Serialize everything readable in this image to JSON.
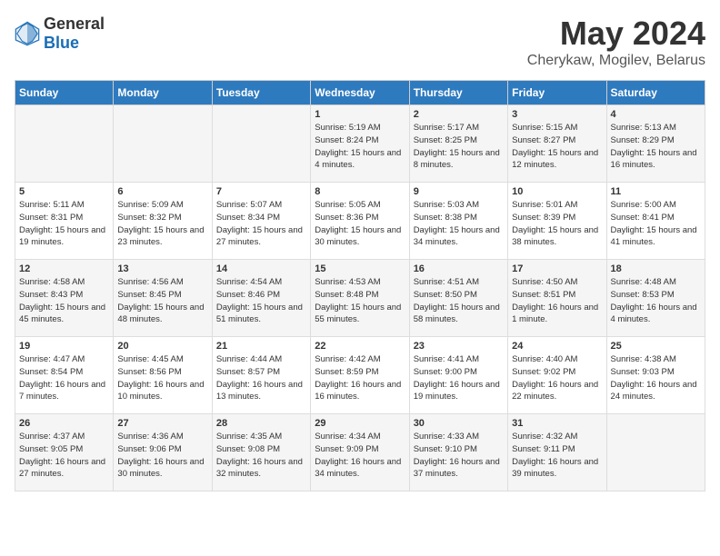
{
  "header": {
    "logo_general": "General",
    "logo_blue": "Blue",
    "title": "May 2024",
    "location": "Cherykaw, Mogilev, Belarus"
  },
  "days_of_week": [
    "Sunday",
    "Monday",
    "Tuesday",
    "Wednesday",
    "Thursday",
    "Friday",
    "Saturday"
  ],
  "weeks": [
    [
      {
        "day": "",
        "sunrise": "",
        "sunset": "",
        "daylight": ""
      },
      {
        "day": "",
        "sunrise": "",
        "sunset": "",
        "daylight": ""
      },
      {
        "day": "",
        "sunrise": "",
        "sunset": "",
        "daylight": ""
      },
      {
        "day": "1",
        "sunrise": "Sunrise: 5:19 AM",
        "sunset": "Sunset: 8:24 PM",
        "daylight": "Daylight: 15 hours and 4 minutes."
      },
      {
        "day": "2",
        "sunrise": "Sunrise: 5:17 AM",
        "sunset": "Sunset: 8:25 PM",
        "daylight": "Daylight: 15 hours and 8 minutes."
      },
      {
        "day": "3",
        "sunrise": "Sunrise: 5:15 AM",
        "sunset": "Sunset: 8:27 PM",
        "daylight": "Daylight: 15 hours and 12 minutes."
      },
      {
        "day": "4",
        "sunrise": "Sunrise: 5:13 AM",
        "sunset": "Sunset: 8:29 PM",
        "daylight": "Daylight: 15 hours and 16 minutes."
      }
    ],
    [
      {
        "day": "5",
        "sunrise": "Sunrise: 5:11 AM",
        "sunset": "Sunset: 8:31 PM",
        "daylight": "Daylight: 15 hours and 19 minutes."
      },
      {
        "day": "6",
        "sunrise": "Sunrise: 5:09 AM",
        "sunset": "Sunset: 8:32 PM",
        "daylight": "Daylight: 15 hours and 23 minutes."
      },
      {
        "day": "7",
        "sunrise": "Sunrise: 5:07 AM",
        "sunset": "Sunset: 8:34 PM",
        "daylight": "Daylight: 15 hours and 27 minutes."
      },
      {
        "day": "8",
        "sunrise": "Sunrise: 5:05 AM",
        "sunset": "Sunset: 8:36 PM",
        "daylight": "Daylight: 15 hours and 30 minutes."
      },
      {
        "day": "9",
        "sunrise": "Sunrise: 5:03 AM",
        "sunset": "Sunset: 8:38 PM",
        "daylight": "Daylight: 15 hours and 34 minutes."
      },
      {
        "day": "10",
        "sunrise": "Sunrise: 5:01 AM",
        "sunset": "Sunset: 8:39 PM",
        "daylight": "Daylight: 15 hours and 38 minutes."
      },
      {
        "day": "11",
        "sunrise": "Sunrise: 5:00 AM",
        "sunset": "Sunset: 8:41 PM",
        "daylight": "Daylight: 15 hours and 41 minutes."
      }
    ],
    [
      {
        "day": "12",
        "sunrise": "Sunrise: 4:58 AM",
        "sunset": "Sunset: 8:43 PM",
        "daylight": "Daylight: 15 hours and 45 minutes."
      },
      {
        "day": "13",
        "sunrise": "Sunrise: 4:56 AM",
        "sunset": "Sunset: 8:45 PM",
        "daylight": "Daylight: 15 hours and 48 minutes."
      },
      {
        "day": "14",
        "sunrise": "Sunrise: 4:54 AM",
        "sunset": "Sunset: 8:46 PM",
        "daylight": "Daylight: 15 hours and 51 minutes."
      },
      {
        "day": "15",
        "sunrise": "Sunrise: 4:53 AM",
        "sunset": "Sunset: 8:48 PM",
        "daylight": "Daylight: 15 hours and 55 minutes."
      },
      {
        "day": "16",
        "sunrise": "Sunrise: 4:51 AM",
        "sunset": "Sunset: 8:50 PM",
        "daylight": "Daylight: 15 hours and 58 minutes."
      },
      {
        "day": "17",
        "sunrise": "Sunrise: 4:50 AM",
        "sunset": "Sunset: 8:51 PM",
        "daylight": "Daylight: 16 hours and 1 minute."
      },
      {
        "day": "18",
        "sunrise": "Sunrise: 4:48 AM",
        "sunset": "Sunset: 8:53 PM",
        "daylight": "Daylight: 16 hours and 4 minutes."
      }
    ],
    [
      {
        "day": "19",
        "sunrise": "Sunrise: 4:47 AM",
        "sunset": "Sunset: 8:54 PM",
        "daylight": "Daylight: 16 hours and 7 minutes."
      },
      {
        "day": "20",
        "sunrise": "Sunrise: 4:45 AM",
        "sunset": "Sunset: 8:56 PM",
        "daylight": "Daylight: 16 hours and 10 minutes."
      },
      {
        "day": "21",
        "sunrise": "Sunrise: 4:44 AM",
        "sunset": "Sunset: 8:57 PM",
        "daylight": "Daylight: 16 hours and 13 minutes."
      },
      {
        "day": "22",
        "sunrise": "Sunrise: 4:42 AM",
        "sunset": "Sunset: 8:59 PM",
        "daylight": "Daylight: 16 hours and 16 minutes."
      },
      {
        "day": "23",
        "sunrise": "Sunrise: 4:41 AM",
        "sunset": "Sunset: 9:00 PM",
        "daylight": "Daylight: 16 hours and 19 minutes."
      },
      {
        "day": "24",
        "sunrise": "Sunrise: 4:40 AM",
        "sunset": "Sunset: 9:02 PM",
        "daylight": "Daylight: 16 hours and 22 minutes."
      },
      {
        "day": "25",
        "sunrise": "Sunrise: 4:38 AM",
        "sunset": "Sunset: 9:03 PM",
        "daylight": "Daylight: 16 hours and 24 minutes."
      }
    ],
    [
      {
        "day": "26",
        "sunrise": "Sunrise: 4:37 AM",
        "sunset": "Sunset: 9:05 PM",
        "daylight": "Daylight: 16 hours and 27 minutes."
      },
      {
        "day": "27",
        "sunrise": "Sunrise: 4:36 AM",
        "sunset": "Sunset: 9:06 PM",
        "daylight": "Daylight: 16 hours and 30 minutes."
      },
      {
        "day": "28",
        "sunrise": "Sunrise: 4:35 AM",
        "sunset": "Sunset: 9:08 PM",
        "daylight": "Daylight: 16 hours and 32 minutes."
      },
      {
        "day": "29",
        "sunrise": "Sunrise: 4:34 AM",
        "sunset": "Sunset: 9:09 PM",
        "daylight": "Daylight: 16 hours and 34 minutes."
      },
      {
        "day": "30",
        "sunrise": "Sunrise: 4:33 AM",
        "sunset": "Sunset: 9:10 PM",
        "daylight": "Daylight: 16 hours and 37 minutes."
      },
      {
        "day": "31",
        "sunrise": "Sunrise: 4:32 AM",
        "sunset": "Sunset: 9:11 PM",
        "daylight": "Daylight: 16 hours and 39 minutes."
      },
      {
        "day": "",
        "sunrise": "",
        "sunset": "",
        "daylight": ""
      }
    ]
  ]
}
